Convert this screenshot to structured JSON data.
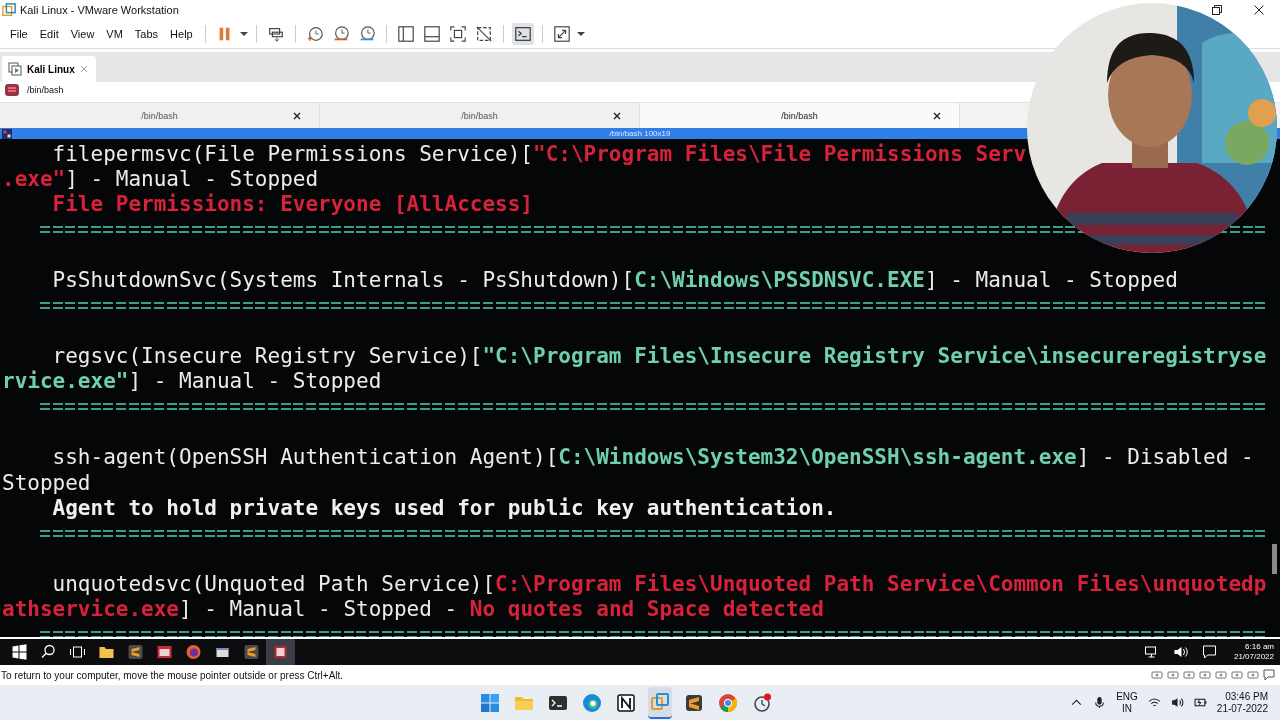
{
  "window": {
    "title": "Kali Linux - VMware Workstation"
  },
  "menu": [
    "File",
    "Edit",
    "View",
    "VM",
    "Tabs",
    "Help"
  ],
  "vm_tab": {
    "label": "Kali Linux"
  },
  "breadcrumb": "/bin/bash",
  "terminal_tabs": [
    {
      "label": "/bin/bash",
      "selected": false
    },
    {
      "label": "/bin/bash",
      "selected": false
    },
    {
      "label": "/bin/bash",
      "selected": true
    }
  ],
  "terminal": {
    "title": "/bin/bash 100x19",
    "lines": [
      {
        "kind": "text",
        "indented": true,
        "segments": [
          {
            "kind": "plain",
            "text": "filepermsvc(File Permissions Service)["
          },
          {
            "kind": "warning",
            "text": "\"C:\\Program Files\\File Permissions Serv"
          }
        ]
      },
      {
        "kind": "text",
        "indented": false,
        "segments": [
          {
            "kind": "warning",
            "text": ".exe\""
          },
          {
            "kind": "plain",
            "text": "] - Manual - Stopped"
          }
        ]
      },
      {
        "kind": "text",
        "indented": true,
        "segments": [
          {
            "kind": "warning",
            "text": "File Permissions: Everyone [AllAccess]"
          }
        ]
      },
      {
        "kind": "rule"
      },
      {
        "kind": "blank"
      },
      {
        "kind": "text",
        "indented": true,
        "segments": [
          {
            "kind": "plain",
            "text": "PsShutdownSvc(Systems Internals - PsShutdown)["
          },
          {
            "kind": "path",
            "text": "C:\\Windows\\PSSDNSVC.EXE"
          },
          {
            "kind": "plain",
            "text": "] - Manual - Stopped"
          }
        ]
      },
      {
        "kind": "rule"
      },
      {
        "kind": "blank"
      },
      {
        "kind": "text",
        "indented": true,
        "segments": [
          {
            "kind": "plain",
            "text": "regsvc(Insecure Registry Service)["
          },
          {
            "kind": "path",
            "text": "\"C:\\Program Files\\Insecure Registry Service\\insecureregistryse"
          }
        ]
      },
      {
        "kind": "text",
        "indented": false,
        "segments": [
          {
            "kind": "path",
            "text": "rvice.exe\""
          },
          {
            "kind": "plain",
            "text": "] - Manual - Stopped"
          }
        ]
      },
      {
        "kind": "rule"
      },
      {
        "kind": "blank"
      },
      {
        "kind": "text",
        "indented": true,
        "segments": [
          {
            "kind": "plain",
            "text": "ssh-agent(OpenSSH Authentication Agent)["
          },
          {
            "kind": "path",
            "text": "C:\\Windows\\System32\\OpenSSH\\ssh-agent.exe"
          },
          {
            "kind": "plain",
            "text": "] - Disabled -"
          }
        ]
      },
      {
        "kind": "text",
        "indented": false,
        "segments": [
          {
            "kind": "plain",
            "text": "Stopped"
          }
        ]
      },
      {
        "kind": "text",
        "indented": true,
        "segments": [
          {
            "kind": "note",
            "text": "Agent to hold private keys used for public key authentication."
          }
        ]
      },
      {
        "kind": "rule"
      },
      {
        "kind": "blank"
      },
      {
        "kind": "text",
        "indented": true,
        "segments": [
          {
            "kind": "plain",
            "text": "unquotedsvc(Unquoted Path Service)["
          },
          {
            "kind": "warning",
            "text": "C:\\Program Files\\Unquoted Path Service\\Common Files\\unquotedp"
          }
        ]
      },
      {
        "kind": "text",
        "indented": false,
        "segments": [
          {
            "kind": "warning",
            "text": "athservice.exe"
          },
          {
            "kind": "plain",
            "text": "] - Manual - Stopped - "
          },
          {
            "kind": "warning",
            "text": "No quotes and Space detected"
          }
        ]
      },
      {
        "kind": "rule"
      }
    ]
  },
  "guest_taskbar": {
    "time": "6:16 am",
    "date": "21/07/2022"
  },
  "status_bar": "To return to your computer, move the mouse pointer outside or press Ctrl+Alt.",
  "host_taskbar": {
    "language": "ENG",
    "region": "IN",
    "time": "03:46 PM",
    "date": "21-07-2022"
  }
}
